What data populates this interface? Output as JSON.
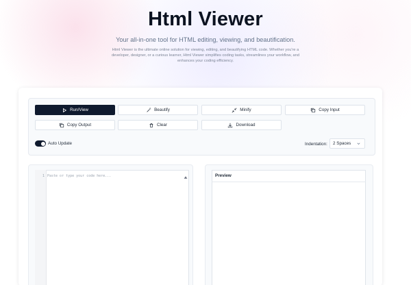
{
  "header": {
    "title": "Html Viewer",
    "subtitle": "Your all-in-one tool for HTML editing, viewing, and beautification.",
    "description": "Html Viewer is the ultimate online solution for viewing, editing, and beautifying HTML code. Whether you're a developer, designer, or a curious learner, Html Viewer simplifies coding tasks, streamlines your workflow, and enhances your coding efficiency."
  },
  "toolbar": {
    "run_label": "Run/View",
    "beautify_label": "Beautify",
    "minify_label": "Minify",
    "copy_input_label": "Copy Input",
    "copy_output_label": "Copy Output",
    "clear_label": "Clear",
    "download_label": "Download",
    "auto_update_label": "Auto Update",
    "auto_update_on": true,
    "indentation_label": "Indentation:",
    "indentation_value": "2 Spaces"
  },
  "editor": {
    "line_number": "1",
    "placeholder": "Paste or type your code here..."
  },
  "preview": {
    "title": "Preview"
  },
  "icons": {
    "run": "play-icon",
    "beautify": "magic-wand-icon",
    "minify": "compress-arrows-icon",
    "copy_input": "copy-icon",
    "copy_output": "copy-icon",
    "clear": "trash-icon",
    "download": "download-icon",
    "select": "chevron-down-icon",
    "scroll": "scroll-up-arrow-icon"
  },
  "colors": {
    "primary": "#0f1a2e",
    "text": "#0f172a",
    "muted": "#64748b"
  }
}
